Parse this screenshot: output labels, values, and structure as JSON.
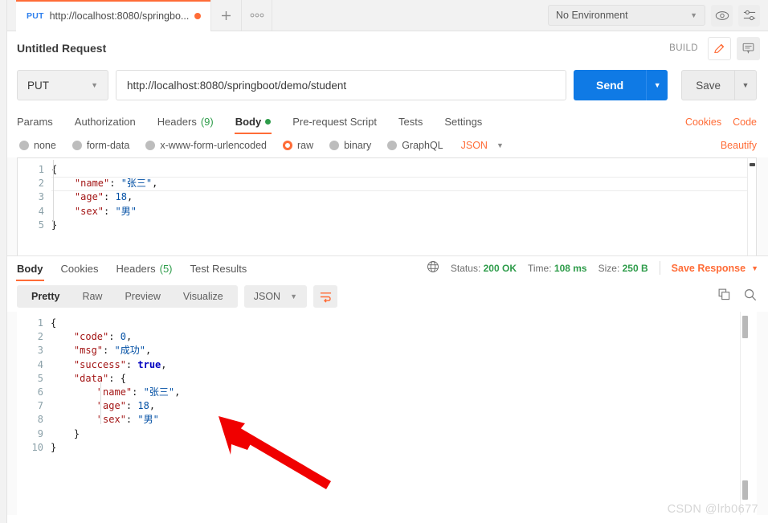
{
  "window": {
    "tab": {
      "method": "PUT",
      "url_short": "http://localhost:8080/springbo...",
      "unsaved_icon": "unsaved-dot"
    },
    "new_tab_icon": "plus-icon",
    "tab_options_icon": "ellipsis-icon",
    "environment": {
      "selected": "No Environment",
      "caret_icon": "chevron-down-icon",
      "eye_icon": "eye-icon",
      "settings_icon": "sliders-icon"
    }
  },
  "request": {
    "title": "Untitled Request",
    "build_label": "BUILD",
    "edit_icon": "pencil-icon",
    "comment_icon": "comment-icon",
    "method": "PUT",
    "url": "http://localhost:8080/springboot/demo/student",
    "send_label": "Send",
    "send_caret_icon": "chevron-down-icon",
    "save_label": "Save",
    "save_caret_icon": "chevron-down-icon",
    "tabs": [
      {
        "label": "Params",
        "count": "",
        "active": false
      },
      {
        "label": "Authorization",
        "count": "",
        "active": false
      },
      {
        "label": "Headers",
        "count": "(9)",
        "active": false
      },
      {
        "label": "Body",
        "count": "",
        "active": true
      },
      {
        "label": "Pre-request Script",
        "count": "",
        "active": false
      },
      {
        "label": "Tests",
        "count": "",
        "active": false
      },
      {
        "label": "Settings",
        "count": "",
        "active": false
      }
    ],
    "cookies_link": "Cookies",
    "code_link": "Code",
    "body_types": [
      {
        "label": "none",
        "selected": false
      },
      {
        "label": "form-data",
        "selected": false
      },
      {
        "label": "x-www-form-urlencoded",
        "selected": false
      },
      {
        "label": "raw",
        "selected": true
      },
      {
        "label": "binary",
        "selected": false
      },
      {
        "label": "GraphQL",
        "selected": false
      }
    ],
    "raw_format": "JSON",
    "raw_format_caret_icon": "chevron-down-icon",
    "beautify_label": "Beautify",
    "body_lines": [
      {
        "n": "1",
        "segments": [
          {
            "t": "punc",
            "v": "{"
          }
        ]
      },
      {
        "n": "2",
        "segments": [
          {
            "t": "key",
            "v": "    \"name\""
          },
          {
            "t": "punc",
            "v": ": "
          },
          {
            "t": "str",
            "v": "\"张三\""
          },
          {
            "t": "punc",
            "v": ","
          }
        ]
      },
      {
        "n": "3",
        "segments": [
          {
            "t": "key",
            "v": "    \"age\""
          },
          {
            "t": "punc",
            "v": ": "
          },
          {
            "t": "num",
            "v": "18"
          },
          {
            "t": "punc",
            "v": ","
          }
        ]
      },
      {
        "n": "4",
        "segments": [
          {
            "t": "key",
            "v": "    \"sex\""
          },
          {
            "t": "punc",
            "v": ": "
          },
          {
            "t": "str",
            "v": "\"男\""
          }
        ]
      },
      {
        "n": "5",
        "segments": [
          {
            "t": "punc",
            "v": "}"
          }
        ]
      }
    ]
  },
  "response": {
    "tabs": [
      {
        "label": "Body",
        "count": "",
        "active": true
      },
      {
        "label": "Cookies",
        "count": "",
        "active": false
      },
      {
        "label": "Headers",
        "count": "(5)",
        "active": false
      },
      {
        "label": "Test Results",
        "count": "",
        "active": false
      }
    ],
    "globe_icon": "globe-icon",
    "status_label": "Status:",
    "status_value": "200 OK",
    "time_label": "Time:",
    "time_value": "108 ms",
    "size_label": "Size:",
    "size_value": "250 B",
    "save_response_label": "Save Response",
    "save_response_caret_icon": "chevron-down-icon",
    "view_modes": [
      {
        "label": "Pretty",
        "active": true
      },
      {
        "label": "Raw",
        "active": false
      },
      {
        "label": "Preview",
        "active": false
      },
      {
        "label": "Visualize",
        "active": false
      }
    ],
    "format": "JSON",
    "format_caret_icon": "chevron-down-icon",
    "wrap_icon": "word-wrap-icon",
    "copy_icon": "copy-icon",
    "search_icon": "search-icon",
    "body_lines": [
      {
        "n": "1",
        "segments": [
          {
            "t": "punc",
            "v": "{"
          }
        ]
      },
      {
        "n": "2",
        "segments": [
          {
            "t": "key",
            "v": "    \"code\""
          },
          {
            "t": "punc",
            "v": ": "
          },
          {
            "t": "num",
            "v": "0"
          },
          {
            "t": "punc",
            "v": ","
          }
        ]
      },
      {
        "n": "3",
        "segments": [
          {
            "t": "key",
            "v": "    \"msg\""
          },
          {
            "t": "punc",
            "v": ": "
          },
          {
            "t": "str",
            "v": "\"成功\""
          },
          {
            "t": "punc",
            "v": ","
          }
        ]
      },
      {
        "n": "4",
        "segments": [
          {
            "t": "key",
            "v": "    \"success\""
          },
          {
            "t": "punc",
            "v": ": "
          },
          {
            "t": "bool",
            "v": "true"
          },
          {
            "t": "punc",
            "v": ","
          }
        ]
      },
      {
        "n": "5",
        "segments": [
          {
            "t": "key",
            "v": "    \"data\""
          },
          {
            "t": "punc",
            "v": ": {"
          }
        ]
      },
      {
        "n": "6",
        "segments": [
          {
            "t": "key",
            "v": "        \"name\""
          },
          {
            "t": "punc",
            "v": ": "
          },
          {
            "t": "str",
            "v": "\"张三\""
          },
          {
            "t": "punc",
            "v": ","
          }
        ]
      },
      {
        "n": "7",
        "segments": [
          {
            "t": "key",
            "v": "        \"age\""
          },
          {
            "t": "punc",
            "v": ": "
          },
          {
            "t": "num",
            "v": "18"
          },
          {
            "t": "punc",
            "v": ","
          }
        ]
      },
      {
        "n": "8",
        "segments": [
          {
            "t": "key",
            "v": "        \"sex\""
          },
          {
            "t": "punc",
            "v": ": "
          },
          {
            "t": "str",
            "v": "\"男\""
          }
        ]
      },
      {
        "n": "9",
        "segments": [
          {
            "t": "punc",
            "v": "    }"
          }
        ]
      },
      {
        "n": "10",
        "segments": [
          {
            "t": "punc",
            "v": "}"
          }
        ]
      }
    ]
  },
  "annotation": {
    "arrow_color": "#f00000",
    "arrow_name": "red-pointer-arrow"
  },
  "watermark": "CSDN @lrb0677",
  "colors": {
    "accent": "#ff6c37",
    "send_blue": "#0f7ae5",
    "status_green": "#2e9c4a",
    "method_blue": "#2f80ed"
  }
}
